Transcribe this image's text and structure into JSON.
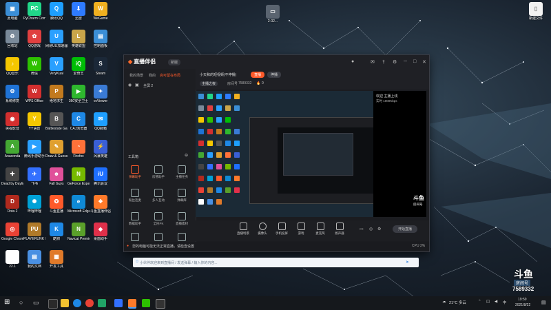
{
  "desktop": {
    "icons": [
      {
        "label": "此电脑",
        "glyph": "▣",
        "color": "#3b8ed6"
      },
      {
        "label": "PyCharm Commun...",
        "glyph": "PC",
        "color": "#21d789"
      },
      {
        "label": "腾讯QQ",
        "glyph": "Q",
        "color": "#1e9fff"
      },
      {
        "label": "迅雷",
        "glyph": "⬇",
        "color": "#2e7bff"
      },
      {
        "label": "WeGame",
        "glyph": "W",
        "color": "#f0b020"
      },
      {
        "label": "回收站",
        "glyph": "♻",
        "color": "#7a8a9a"
      },
      {
        "label": "QQ游戏",
        "glyph": "✿",
        "color": "#e04040"
      },
      {
        "label": "网易UU加速器",
        "glyph": "U",
        "color": "#2aa0ff"
      },
      {
        "label": "英雄联盟",
        "glyph": "L",
        "color": "#c9a54a"
      },
      {
        "label": "控制面板",
        "glyph": "▤",
        "color": "#3b8ed6"
      },
      {
        "label": "QQ音乐",
        "glyph": "♪",
        "color": "#f5c700"
      },
      {
        "label": "微信",
        "glyph": "W",
        "color": "#2dc100"
      },
      {
        "label": "VeryKuai",
        "glyph": "V",
        "color": "#2aa0ff"
      },
      {
        "label": "爱奇艺",
        "glyph": "iQ",
        "color": "#00be06"
      },
      {
        "label": "Steam",
        "glyph": "S",
        "color": "#1b2838"
      },
      {
        "label": "系统修复",
        "glyph": "⚙",
        "color": "#1f73d6"
      },
      {
        "label": "WPS Office",
        "glyph": "W",
        "color": "#d32f2f"
      },
      {
        "label": "绝地求生",
        "glyph": "P",
        "color": "#c27a1e"
      },
      {
        "label": "360安全卫士",
        "glyph": "▶",
        "color": "#2eb82e"
      },
      {
        "label": "vsViewer",
        "glyph": "✦",
        "color": "#3a7bd5"
      },
      {
        "label": "央视影音",
        "glyph": "◉",
        "color": "#d32f2f"
      },
      {
        "label": "YY语音",
        "glyph": "Y",
        "color": "#f5c700"
      },
      {
        "label": "Battlestate Games",
        "glyph": "B",
        "color": "#555555"
      },
      {
        "label": "CAJ浏览器",
        "glyph": "C",
        "color": "#1e88e5"
      },
      {
        "label": "QQ邮箱",
        "glyph": "✉",
        "color": "#1e9fff"
      },
      {
        "label": "Anaconda",
        "glyph": "A",
        "color": "#44a833"
      },
      {
        "label": "腾讯手游助手",
        "glyph": "▶",
        "color": "#2aa0ff"
      },
      {
        "label": "Draw & Guess",
        "glyph": "✎",
        "color": "#e0a030"
      },
      {
        "label": "Firefox",
        "glyph": "◔",
        "color": "#ff7139"
      },
      {
        "label": "风暴英雄",
        "glyph": "⚡",
        "color": "#3a5fd6"
      },
      {
        "label": "Dead by Daylight",
        "glyph": "✚",
        "color": "#444444"
      },
      {
        "label": "飞书",
        "glyph": "✈",
        "color": "#3370ff"
      },
      {
        "label": "Fall Guys",
        "glyph": "☻",
        "color": "#e0509a"
      },
      {
        "label": "GeForce Experience",
        "glyph": "N",
        "color": "#76b900"
      },
      {
        "label": "腾讯会议",
        "glyph": "iU",
        "color": "#1e6fff"
      },
      {
        "label": "Dota 2",
        "glyph": "D",
        "color": "#b02a1e"
      },
      {
        "label": "哔哩哔哩",
        "glyph": "✺",
        "color": "#00a1d6"
      },
      {
        "label": "斗鱼直播",
        "glyph": "✪",
        "color": "#ff5a2a"
      },
      {
        "label": "Microsoft Edge",
        "glyph": "e",
        "color": "#0f8ad6"
      },
      {
        "label": "斗鱼直播伴侣",
        "glyph": "❖",
        "color": "#ff7a2a"
      },
      {
        "label": "Google Chrome",
        "glyph": "◎",
        "color": "#e94235"
      },
      {
        "label": "PLAYERUNK BATTLEGR...",
        "glyph": "PU",
        "color": "#b07a2a"
      },
      {
        "label": "酷狗",
        "glyph": "K",
        "color": "#1e88e5"
      },
      {
        "label": "Navicat Premium 12",
        "glyph": "N",
        "color": "#5aa02a"
      },
      {
        "label": "桌面助手",
        "glyph": "◆",
        "color": "#e0304a"
      },
      {
        "label": "22.1",
        "glyph": "◐",
        "color": "#ffffff"
      },
      {
        "label": "我的文档",
        "glyph": "▤",
        "color": "#4a90e2"
      },
      {
        "label": "开发工具",
        "glyph": "▦",
        "color": "#e07a2a"
      }
    ],
    "top_files": [
      {
        "label": "2-02...",
        "glyph": "▭"
      },
      {
        "label": "新建文件",
        "glyph": "▯"
      }
    ]
  },
  "window": {
    "app_name": "直播伴侣",
    "version_badge": "新版",
    "left_tabs": [
      "我的场景",
      "我的",
      "高可留在布局"
    ],
    "visible_toggle": "全屏 2",
    "tools_title": "工具箱",
    "tools": [
      {
        "label": "弹幕助手",
        "active": true
      },
      {
        "label": "房管助手",
        "active": false
      },
      {
        "label": "主播任务",
        "active": false
      },
      {
        "label": "粉丝连麦",
        "active": false
      },
      {
        "label": "多人互动",
        "active": false
      },
      {
        "label": "弹幕库",
        "active": false
      },
      {
        "label": "数据助手",
        "active": false
      },
      {
        "label": "全民PK",
        "active": false
      },
      {
        "label": "直播素材",
        "active": false
      }
    ],
    "stream_title": "小天和的短视频(不停播)",
    "live_tag": "直播",
    "stop_label": "停播",
    "category": "主播之夜",
    "room_id": "7589332",
    "hot_count": "0",
    "controls": [
      {
        "label": "直播场景"
      },
      {
        "label": "摄像头"
      },
      {
        "label": "手机投屏"
      },
      {
        "label": "游戏"
      },
      {
        "label": "麦克风"
      },
      {
        "label": "扬声器"
      }
    ],
    "start_button": "开始直播",
    "bottom_notice": "您的电脑可能无法正常直播，请检查设置",
    "cpu_info": "CPU 2%",
    "overlay_text": "欢迎 主播上线",
    "overlay_sub": "实时 1000Kbps",
    "watermark_top": "斗鱼",
    "watermark_bottom": "房间号"
  },
  "chat": {
    "placeholder": "小伙伴欢迎来到直播间 / 发送弹幕 / 输入你的内容..."
  },
  "watermark": {
    "brand": "斗鱼",
    "room_label": "房间号",
    "room_id": "7589332"
  },
  "taskbar": {
    "weather": "21°C 多云",
    "ime": "中",
    "time": "19:59",
    "date": "2021/8/22"
  }
}
